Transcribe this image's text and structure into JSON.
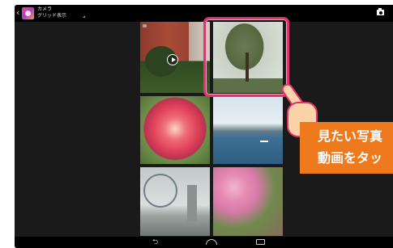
{
  "app": {
    "title": "カメラ",
    "subtitle": "グリッド表示",
    "back_glyph": "‹"
  },
  "topbar_icons": [
    "camera-app-icon",
    "camera-icon"
  ],
  "grid": {
    "thumbnails": [
      {
        "subject": "red brick building with trees",
        "is_video": true
      },
      {
        "subject": "large tree in park",
        "is_video": false,
        "highlighted": true
      },
      {
        "subject": "pink dahlia flower",
        "is_video": false
      },
      {
        "subject": "sea with boats",
        "is_video": false
      },
      {
        "subject": "ferris wheel and city",
        "is_video": false
      },
      {
        "subject": "pink flower field",
        "is_video": false
      }
    ]
  },
  "callout": {
    "line1": "見たい写真",
    "line2": "動画をタッ"
  },
  "navbar": {
    "back_glyph": "⮌"
  },
  "colors": {
    "highlight": "#e2336f",
    "callout_bg": "#ef7a1e",
    "screen_bg": "#1a1a1a"
  }
}
